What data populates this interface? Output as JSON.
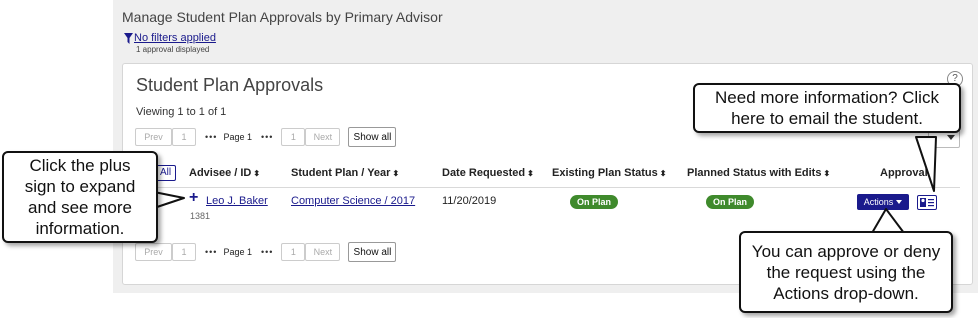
{
  "page": {
    "title": "Manage Student Plan Approvals by Primary Advisor",
    "filter_link": "No filters applied",
    "approval_count": "1 approval displayed"
  },
  "panel": {
    "title": "Student Plan Approvals",
    "help": "?",
    "viewing": "Viewing 1 to 1 of 1"
  },
  "pager": {
    "prev": "Prev",
    "first_page": "1",
    "ellipsis": "•••",
    "page_label": "Page 1",
    "last_page": "1",
    "next": "Next",
    "show_all": "Show all"
  },
  "table": {
    "select_all": "All",
    "headers": [
      "Advisee / ID",
      "Student Plan / Year",
      "Date Requested",
      "Existing Plan Status",
      "Planned Status with Edits",
      "Approval"
    ],
    "sort_glyph": "⬍",
    "rows": [
      {
        "expand": "+",
        "advisee": "Leo J. Baker",
        "id": "1381",
        "plan": "Computer Science / 2017",
        "date": "11/20/2019",
        "existing_status": "On Plan",
        "planned_status": "On Plan",
        "actions": "Actions"
      }
    ]
  },
  "callouts": {
    "plus": "Click the plus sign to expand and see more information.",
    "email": "Need more information? Click here to email the student.",
    "actions": "You can approve or deny the request using the Actions drop-down."
  },
  "colors": {
    "link": "#1a1a8c",
    "badge_green": "#3f8a2c",
    "page_bg": "#efefef"
  },
  "icons": [
    "filter-icon",
    "help-icon",
    "plus-icon",
    "sort-icon",
    "caret-down-icon",
    "contact-card-icon"
  ]
}
